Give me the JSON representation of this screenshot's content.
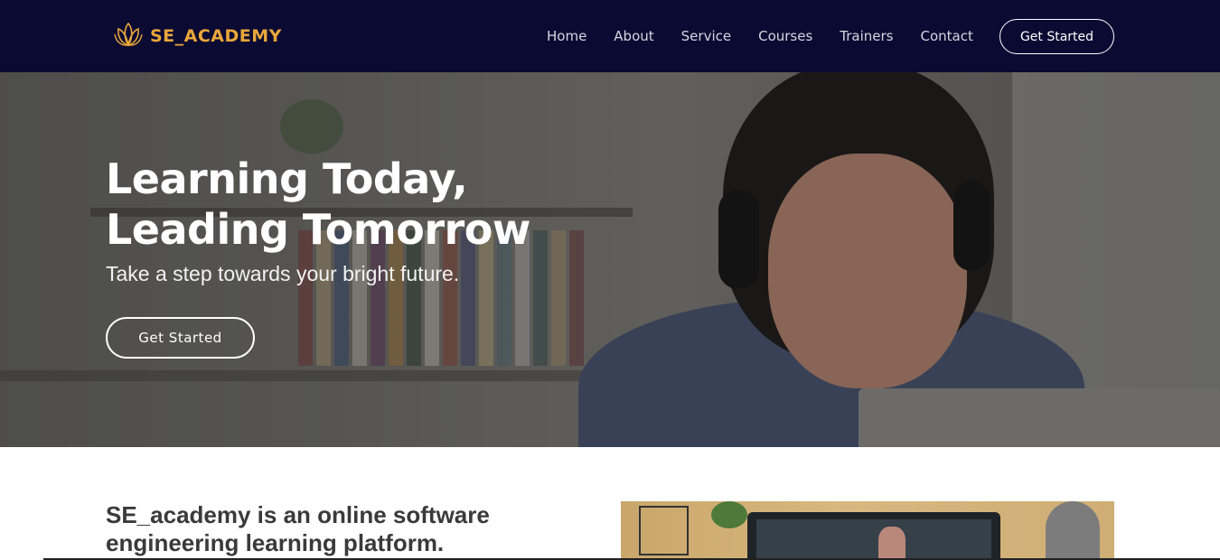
{
  "navbar": {
    "brand": "SE_ACADEMY",
    "links": [
      "Home",
      "About",
      "Service",
      "Courses",
      "Trainers",
      "Contact"
    ],
    "cta": "Get Started"
  },
  "hero": {
    "title_line1": "Learning Today,",
    "title_line2": "Leading Tomorrow",
    "subtitle": "Take a step towards your bright future.",
    "cta": "Get Started"
  },
  "about": {
    "text_line1": "SE_academy is an online software",
    "text_line2": "engineering learning platform."
  },
  "colors": {
    "navbar_bg": "#0b0a33",
    "brand": "#e8a73a"
  },
  "icons": {
    "brand_logo": "lotus-icon"
  }
}
